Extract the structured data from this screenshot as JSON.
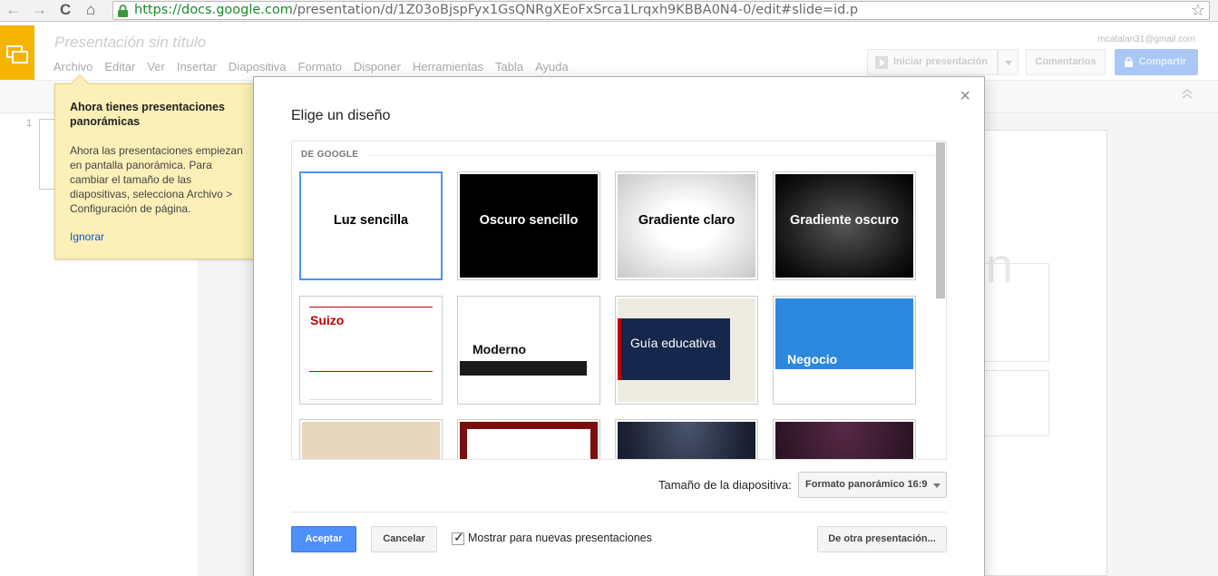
{
  "browser": {
    "back": "←",
    "forward": "→",
    "reload": "C",
    "home": "⌂",
    "url_scheme": "https://",
    "url_host": "docs.google.com",
    "url_path": "/presentation/d/1Z03oBjspFyx1GsQNRgXEoFxSrca1Lrqxh9KBBA0N4-0/edit#slide=id.p",
    "star": "☆"
  },
  "app": {
    "doc_title": "Presentación sin título",
    "user_email": "mcatalan31@gmail.com",
    "menu": [
      "Archivo",
      "Editar",
      "Ver",
      "Insertar",
      "Diapositiva",
      "Formato",
      "Disponer",
      "Herramientas",
      "Tabla",
      "Ayuda"
    ],
    "present_label": "Iniciar presentación",
    "comments_label": "Comentarios",
    "share_label": "Compartir",
    "slide_number": "1",
    "bg_glyph": "n"
  },
  "tooltip": {
    "title": "Ahora tienes presentaciones panorámicas",
    "body": "Ahora las presentaciones empiezan en pantalla panorámica. Para cambiar el tamaño de las diapositivas, selecciona Archivo > Configuración de página.",
    "ignore_label": "Ignorar"
  },
  "dialog": {
    "title": "Elige un diseño",
    "close": "×",
    "section_label": "DE GOOGLE",
    "themes": [
      {
        "name": "Luz sencilla",
        "selected": true
      },
      {
        "name": "Oscuro sencillo"
      },
      {
        "name": "Gradiente claro"
      },
      {
        "name": "Gradiente oscuro"
      },
      {
        "name": "Suizo"
      },
      {
        "name": "Moderno"
      },
      {
        "name": "Guía educativa"
      },
      {
        "name": "Negocio"
      }
    ],
    "size_label": "Tamaño de la diapositiva:",
    "size_value": "Formato panorámico 16:9",
    "accept_label": "Aceptar",
    "cancel_label": "Cancelar",
    "show_label": "Mostrar para nuevas presentaciones",
    "show_checked": true,
    "check": "✓",
    "other_label": "De otra presentación..."
  },
  "colors": {
    "accent_blue": "#4d90fe",
    "slides_yellow": "#f4b400",
    "tooltip_bg": "#fbf0b7",
    "swiss_red": "#c00000",
    "negocio_blue": "#2c88dd",
    "edu_navy": "#15284b"
  }
}
